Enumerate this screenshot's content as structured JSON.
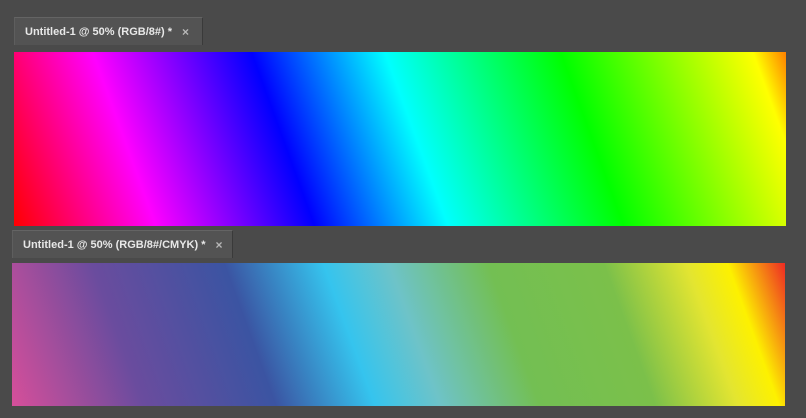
{
  "documents": [
    {
      "tab_title": "Untitled-1 @ 50% (RGB/8#) *",
      "close_glyph": "×",
      "gradient": [
        "#ff0000",
        "#ff00ff",
        "#0000ff",
        "#00ffff",
        "#00ff00",
        "#ffff00",
        "#ff8000"
      ]
    },
    {
      "tab_title": "Untitled-1 @ 50% (RGB/8#/CMYK) *",
      "close_glyph": "×",
      "gradient": [
        "#d64f9a",
        "#6a4c9e",
        "#3b54a2",
        "#35c4ee",
        "#73bf53",
        "#fdf100",
        "#ee2a24"
      ]
    }
  ],
  "colors": {
    "workspace_bg": "#4a4a4a",
    "tab_bg": "#535353",
    "tab_text": "#e8e8e8",
    "close_icon": "#b8b8b8"
  }
}
